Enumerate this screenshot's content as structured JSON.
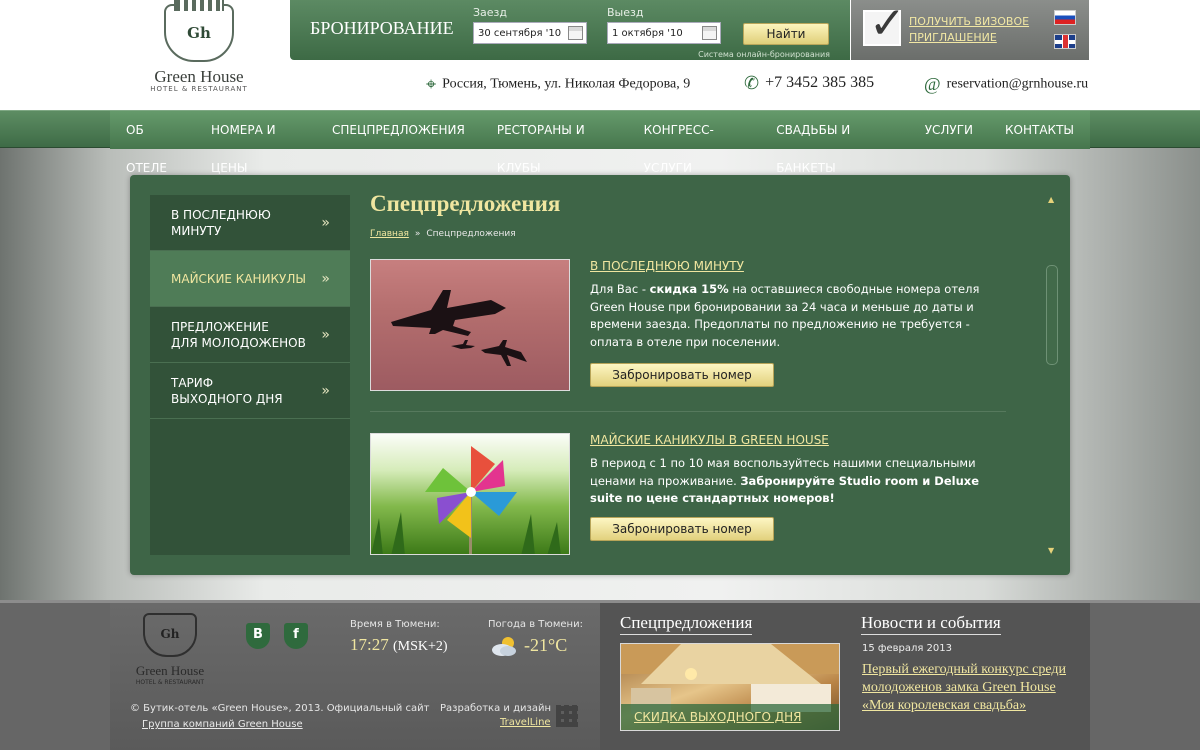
{
  "logo": {
    "name": "Green House",
    "sub": "HOTEL & RESTAURANT",
    "monogram": "Gh"
  },
  "booking": {
    "title": "БРОНИРОВАНИЕ",
    "checkin_label": "Заезд",
    "checkin_value": "30 сентября '10",
    "checkout_label": "Выезд",
    "checkout_value": "1 октября '10",
    "find_label": "Найти",
    "system_note": "Система онлайн-бронирования"
  },
  "visa": {
    "line1": "ПОЛУЧИТЬ ВИЗОВОЕ",
    "line2": "ПРИГЛАШЕНИЕ"
  },
  "contacts": {
    "address": "Россия, Тюмень, ул. Николая Федорова, 9",
    "phone": "+7 3452 385 385",
    "email": "reservation@grnhouse.ru"
  },
  "nav": [
    "ОБ ОТЕЛЕ",
    "НОМЕРА И ЦЕНЫ",
    "СПЕЦПРЕДЛОЖЕНИЯ",
    "РЕСТОРАНЫ И КЛУБЫ",
    "КОНГРЕСС-УСЛУГИ",
    "СВАДЬБЫ И БАНКЕТЫ",
    "УСЛУГИ",
    "КОНТАКТЫ"
  ],
  "submenu": [
    {
      "line1": "В ПОСЛЕДНЮЮ",
      "line2": "МИНУТУ",
      "active": false
    },
    {
      "line1": "МАЙСКИЕ КАНИКУЛЫ",
      "line2": "",
      "active": true
    },
    {
      "line1": "ПРЕДЛОЖЕНИЕ",
      "line2": "ДЛЯ МОЛОДОЖЕНОВ",
      "active": false
    },
    {
      "line1": "ТАРИФ",
      "line2": "ВЫХОДНОГО ДНЯ",
      "active": false
    }
  ],
  "page": {
    "title": "Спецпредложения",
    "crumb_home": "Главная",
    "crumb_sep": "»",
    "crumb_current": "Спецпредложения"
  },
  "offers": [
    {
      "title": "В ПОСЛЕДНЮЮ МИНУТУ",
      "text_a": "Для Вас - ",
      "text_b": "скидка 15%",
      "text_c": " на оставшиеся свободные номера отеля Green House при бронировании за 24 часа и меньше до даты и времени заезда. Предоплаты по предложению не требуется - оплата в отеле при поселении.",
      "button": "Забронировать номер"
    },
    {
      "title": "МАЙСКИЕ КАНИКУЛЫ В GREEN HOUSE",
      "text_a": "В период с 1 по 10 мая воспользуйтесь нашими специальными ценами на проживание. ",
      "text_b": "Забронируйте Studio room и Deluxe suite по цене стандартных номеров!",
      "button": "Забронировать номер"
    }
  ],
  "footer": {
    "social_vk": "B",
    "social_fb": "f",
    "time_label": "Время в Тюмени:",
    "time_value": "17:27",
    "time_zone": "(MSK+2)",
    "weather_label": "Погода в Тюмени:",
    "weather_value": "-21°C",
    "copyright": "© Бутик-отель «Green House», 2013. Официальный сайт",
    "group_link": "Группа компаний Green House",
    "dev_label": "Разработка и дизайн",
    "dev_link": "TravelLine",
    "spec_heading": "Спецпредложения",
    "spec_link": "СКИДКА ВЫХОДНОГО ДНЯ",
    "news_heading": "Новости и события",
    "news_date": "15 февраля 2013",
    "news_link": "Первый ежегодный конкурс среди молодоженов замка Green House «Моя королевская свадьба»"
  },
  "colors": {
    "brand_green": "#3e6547",
    "accent_gold": "#f0e6a0",
    "nav_green": "#5d8d63"
  }
}
